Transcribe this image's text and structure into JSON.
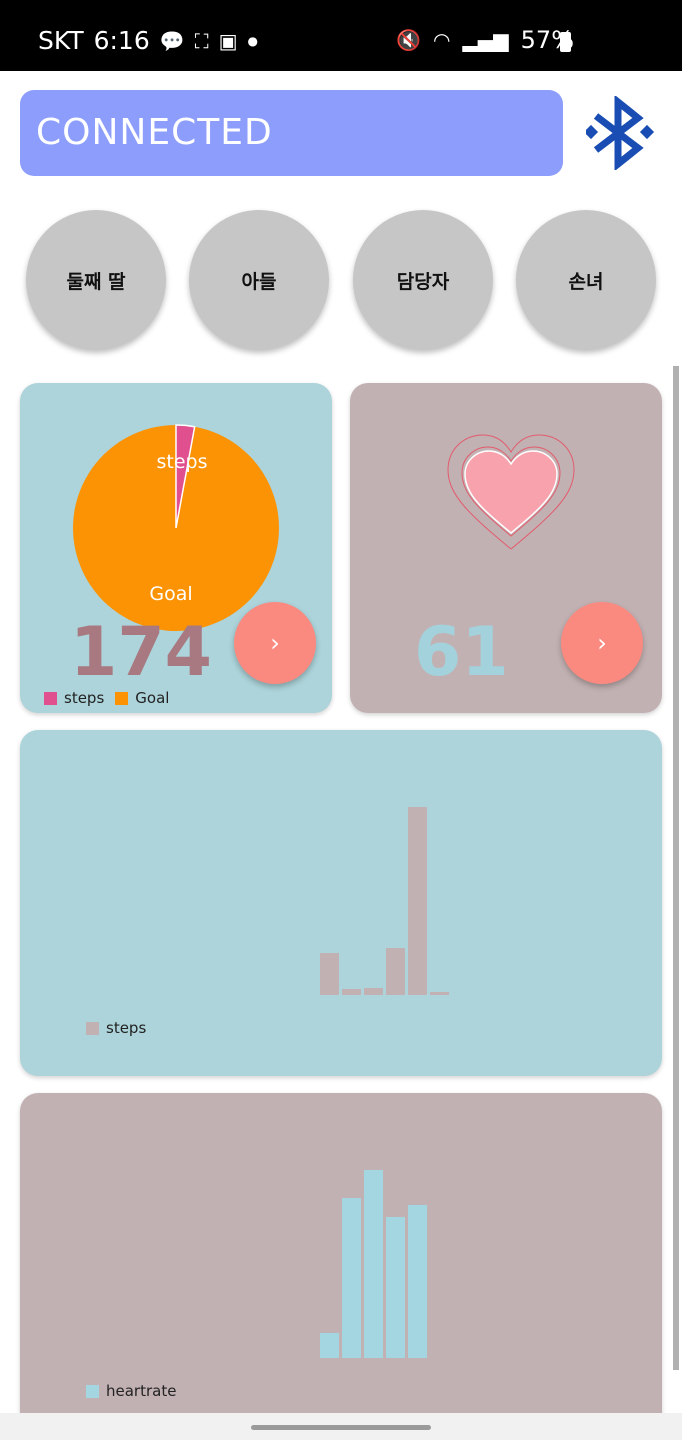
{
  "status_bar": {
    "carrier": "SKT",
    "time": "6:16",
    "battery": "57%",
    "icons": [
      "talk-icon",
      "screenshot-icon",
      "gallery-icon",
      "dot-icon",
      "mute-icon",
      "wifi-icon",
      "signal-icon",
      "battery-icon"
    ]
  },
  "connection": {
    "status": "CONNECTED",
    "icon": "bluetooth-icon"
  },
  "contacts": [
    "둘째 딸",
    "아들",
    "담당자",
    "손녀"
  ],
  "steps_card": {
    "value": "174",
    "arrow": "›",
    "pie_labels": {
      "steps": "steps",
      "goal": "Goal"
    },
    "legend": [
      "steps",
      "Goal"
    ],
    "colors": {
      "steps": "#e0508e",
      "goal": "#fb9305",
      "value": "#a87980"
    }
  },
  "heart_card": {
    "value": "61",
    "arrow": "›",
    "icon": "heart-icon",
    "colors": {
      "value": "#a3d2dc"
    }
  },
  "chart_data": [
    {
      "type": "bar",
      "series": [
        {
          "name": "steps",
          "values": [
            42,
            6,
            7,
            47,
            188,
            3
          ]
        }
      ],
      "legend": [
        "steps"
      ],
      "color": "#c2b1b3"
    },
    {
      "type": "bar",
      "series": [
        {
          "name": "heartrate",
          "values": [
            25,
            160,
            188,
            141,
            153
          ]
        }
      ],
      "legend": [
        "heartrate"
      ],
      "color": "#a3d6e1"
    }
  ]
}
